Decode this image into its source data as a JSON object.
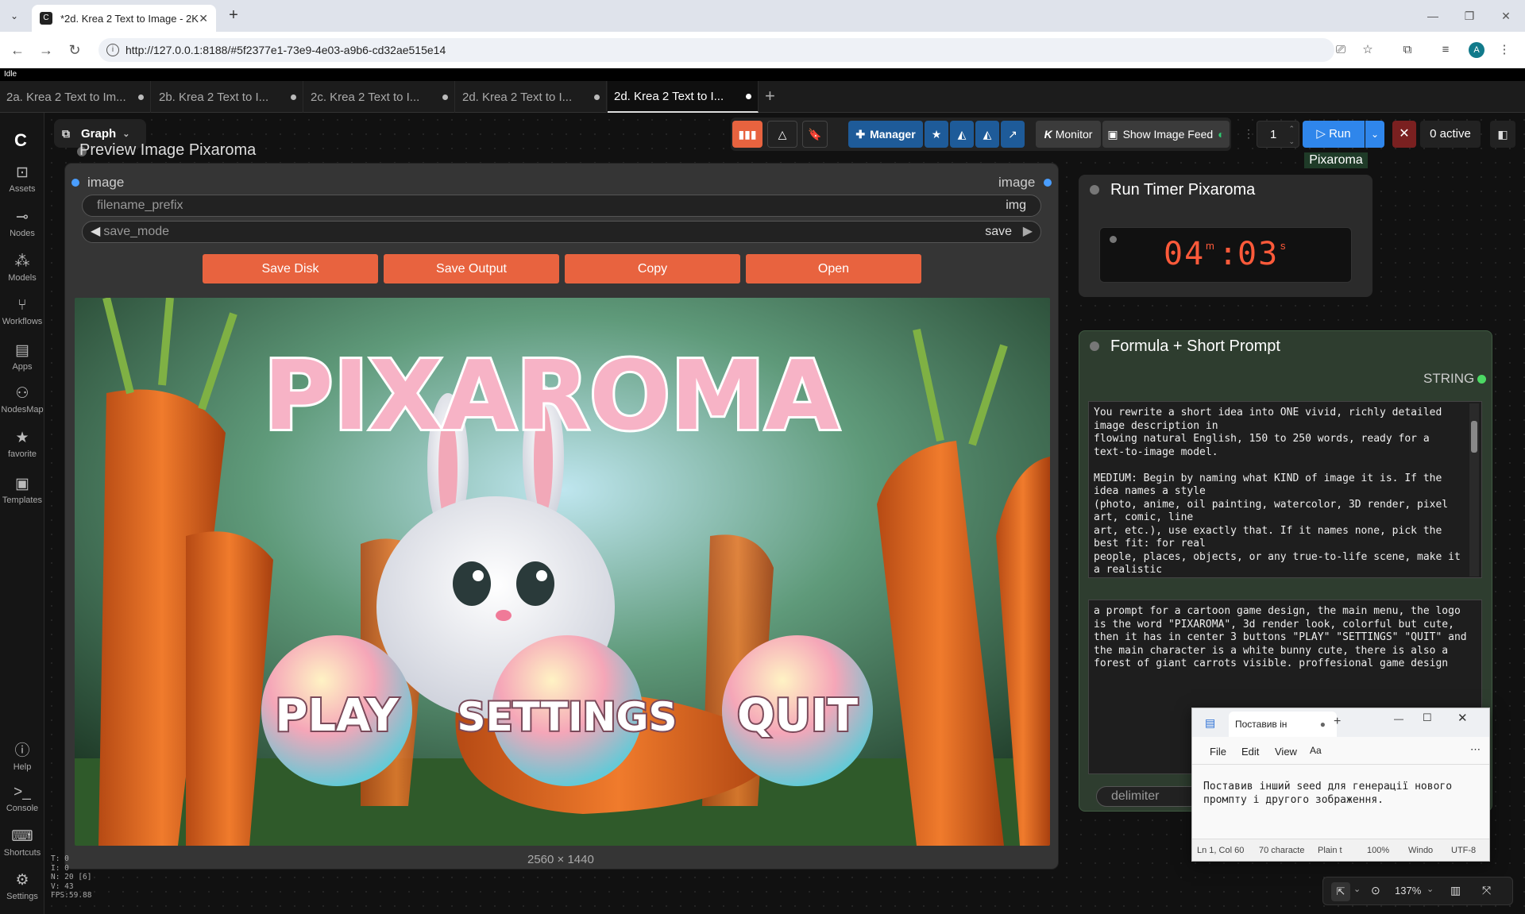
{
  "browser": {
    "tab_title": "*2d. Krea 2 Text to Image - 2K",
    "url": "http://127.0.0.1:8188/#5f2377e1-73e9-4e03-a9b6-cd32ae515e14",
    "profile_initial": "A"
  },
  "app": {
    "status": "Idle",
    "workflow_tabs": [
      {
        "label": "2a. Krea 2 Text to Im..."
      },
      {
        "label": "2b. Krea 2 Text to I..."
      },
      {
        "label": "2c. Krea 2 Text to I..."
      },
      {
        "label": "2d. Krea 2 Text to I..."
      },
      {
        "label": "2d. Krea 2 Text to I..."
      }
    ],
    "graph_label": "Graph"
  },
  "sidebar": {
    "items": [
      {
        "label": "Assets",
        "icon": "image-icon"
      },
      {
        "label": "Nodes",
        "icon": "nodes-icon"
      },
      {
        "label": "Models",
        "icon": "models-icon"
      },
      {
        "label": "Workflows",
        "icon": "workflow-icon"
      },
      {
        "label": "Apps",
        "icon": "apps-icon"
      },
      {
        "label": "NodesMap",
        "icon": "nodesmap-icon"
      },
      {
        "label": "favorite",
        "icon": "star-icon"
      },
      {
        "label": "Templates",
        "icon": "templates-icon"
      },
      {
        "label": "Help",
        "icon": "help-icon"
      },
      {
        "label": "Console",
        "icon": "console-icon"
      },
      {
        "label": "Shortcuts",
        "icon": "keyboard-icon"
      },
      {
        "label": "Settings",
        "icon": "gear-icon"
      }
    ]
  },
  "toolbar": {
    "manager_label": "Manager",
    "monitor_label": "Monitor",
    "image_feed_label": "Show Image Feed",
    "batch_count": "1",
    "run_label": "Run",
    "active_label": "0 active",
    "pixaroma_tag": "Pixaroma"
  },
  "preview_node": {
    "title": "Preview Image Pixaroma",
    "input_label": "image",
    "output_label": "image",
    "filename_prefix_label": "filename_prefix",
    "filename_prefix_value": "img",
    "save_mode_label": "save_mode",
    "save_mode_value": "save",
    "buttons": [
      "Save Disk",
      "Save Output",
      "Copy",
      "Open"
    ],
    "dims": "2560 × 1440",
    "image_text": {
      "logo": "PIXAROMA",
      "play": "PLAY",
      "settings": "SETTINGS",
      "quit": "QUIT"
    }
  },
  "timer_node": {
    "title": "Run Timer Pixaroma",
    "minutes": "04",
    "minutes_unit": "m",
    "seconds": "03",
    "seconds_unit": "s"
  },
  "formula_node": {
    "title": "Formula + Short Prompt",
    "output_label": "STRING",
    "system_prompt": "You rewrite a short idea into ONE vivid, richly detailed image description in\nflowing natural English, 150 to 250 words, ready for a text-to-image model.\n\nMEDIUM: Begin by naming what KIND of image it is. If the idea names a style\n(photo, anime, oil painting, watercolor, 3D render, pixel art, comic, line\nart, etc.), use exactly that. If it names none, pick the best fit: for real\npeople, places, objects, or any true-to-life scene, make it a realistic",
    "user_prompt": "a prompt for a cartoon game design, the main menu, the logo is the word \"PIXAROMA\", 3d render look, colorful but cute, then it has in center 3 buttons \"PLAY\" \"SETTINGS\" \"QUIT\" and the main character is a white bunny cute, there is also a forest of giant carrots visible. proffesional game design",
    "delimiter_label": "delimiter"
  },
  "notepad": {
    "tab_title": "Поставив ін",
    "menu": [
      "File",
      "Edit",
      "View"
    ],
    "text": "Поставив інший seed для генерації нового\nпромпту і другого зображення.",
    "status": [
      "Ln 1, Col 60",
      "70 characte",
      "Plain t",
      "100%",
      "Windo",
      "UTF-8"
    ]
  },
  "stats": [
    "T: 0",
    "I: 0",
    "N: 20 [6]",
    "V: 43",
    "FPS:59.88"
  ],
  "zoom": "137%",
  "colors": {
    "accent_orange": "#e8633f",
    "run_blue": "#2f86eb",
    "manager_blue": "#1e5b99"
  }
}
